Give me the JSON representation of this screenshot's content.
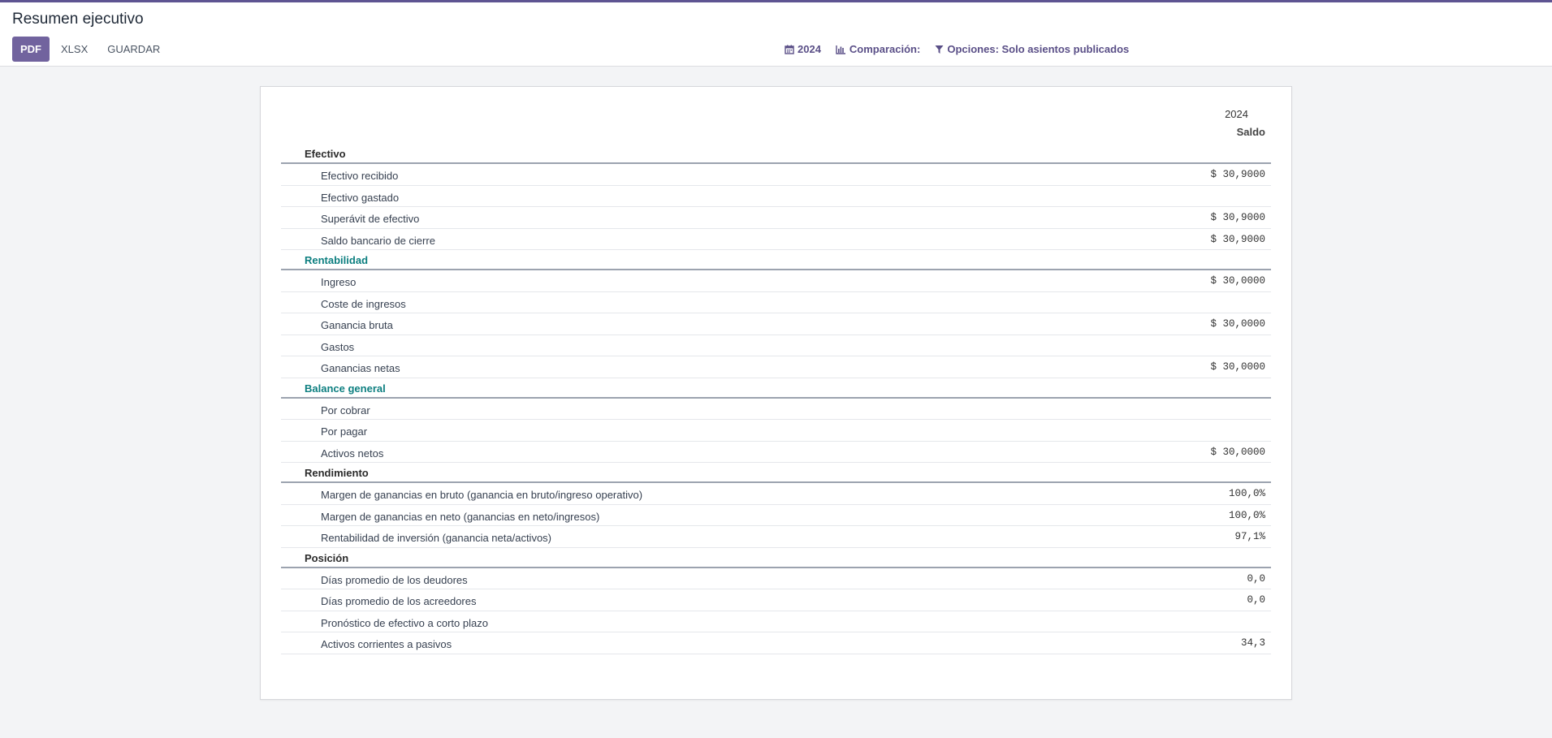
{
  "colors": {
    "accent": "#71639e",
    "teal_section": "#0d7f80",
    "filter_text": "#5a4f87"
  },
  "header": {
    "title": "Resumen ejecutivo",
    "toolbar": {
      "pdf_label": "PDF",
      "xlsx_label": "XLSX",
      "save_label": "GUARDAR"
    },
    "filters": {
      "date_label": "2024",
      "comparison_label": "Comparación:",
      "options_label": "Opciones: Solo asientos publicados"
    }
  },
  "report": {
    "column_year": "2024",
    "column_name": "Saldo",
    "sections": [
      {
        "title": "Efectivo",
        "style": "dark",
        "lines": [
          {
            "label": "Efectivo recibido",
            "value": "$ 30,9000"
          },
          {
            "label": "Efectivo gastado",
            "value": ""
          },
          {
            "label": "Superávit de efectivo",
            "value": "$ 30,9000"
          },
          {
            "label": "Saldo bancario de cierre",
            "value": "$ 30,9000"
          }
        ]
      },
      {
        "title": "Rentabilidad",
        "style": "teal",
        "lines": [
          {
            "label": "Ingreso",
            "value": "$ 30,0000"
          },
          {
            "label": "Coste de ingresos",
            "value": ""
          },
          {
            "label": "Ganancia bruta",
            "value": "$ 30,0000"
          },
          {
            "label": "Gastos",
            "value": ""
          },
          {
            "label": "Ganancias netas",
            "value": "$ 30,0000"
          }
        ]
      },
      {
        "title": "Balance general",
        "style": "teal",
        "lines": [
          {
            "label": "Por cobrar",
            "value": ""
          },
          {
            "label": "Por pagar",
            "value": ""
          },
          {
            "label": "Activos netos",
            "value": "$ 30,0000"
          }
        ]
      },
      {
        "title": "Rendimiento",
        "style": "dark",
        "lines": [
          {
            "label": "Margen de ganancias en bruto (ganancia en bruto/ingreso operativo)",
            "value": "100,0%"
          },
          {
            "label": "Margen de ganancias en neto (ganancias en neto/ingresos)",
            "value": "100,0%"
          },
          {
            "label": "Rentabilidad de inversión (ganancia neta/activos)",
            "value": "97,1%"
          }
        ]
      },
      {
        "title": "Posición",
        "style": "dark",
        "lines": [
          {
            "label": "Días promedio de los deudores",
            "value": "0,0"
          },
          {
            "label": "Días promedio de los acreedores",
            "value": "0,0"
          },
          {
            "label": "Pronóstico de efectivo a corto plazo",
            "value": ""
          },
          {
            "label": "Activos corrientes a pasivos",
            "value": "34,3"
          }
        ]
      }
    ]
  }
}
